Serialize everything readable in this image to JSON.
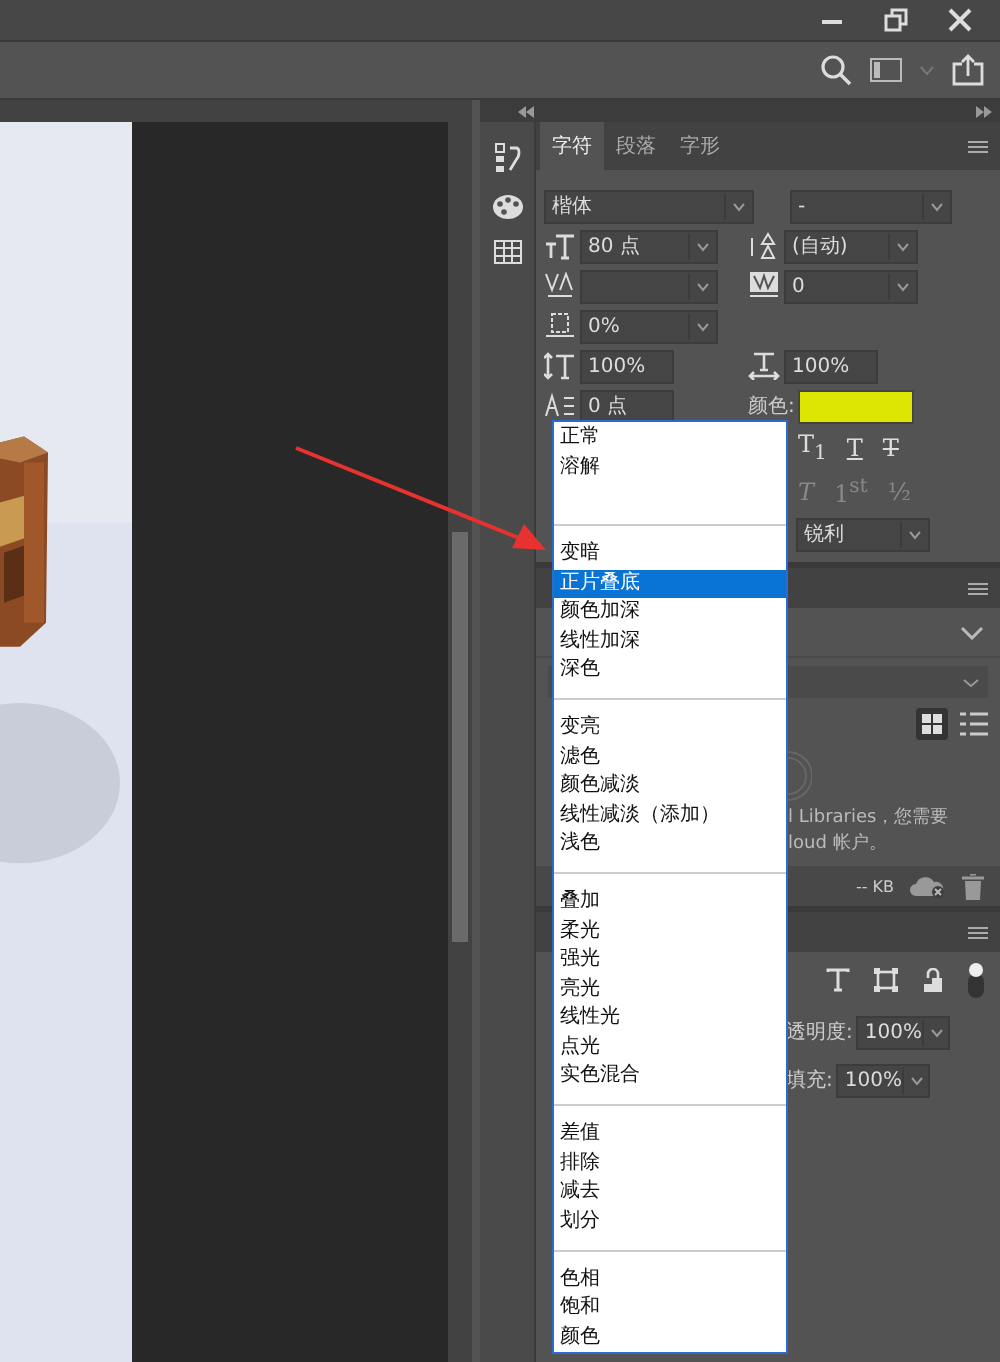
{
  "character_panel": {
    "tabs": [
      {
        "label": "字符",
        "selected": true
      },
      {
        "label": "段落",
        "selected": false
      },
      {
        "label": "字形",
        "selected": false
      }
    ],
    "font_family": "楷体",
    "font_style": "-",
    "font_size": "80 点",
    "leading": "(自动)",
    "tracking": "0",
    "tsume": "0%",
    "vertical_scale": "100%",
    "horizontal_scale": "100%",
    "baseline_shift": "0 点",
    "color_label": "颜色:",
    "style_buttons": [
      {
        "kind": "subscript",
        "label": "T$_{1}$",
        "disabled": false
      },
      {
        "kind": "underline",
        "label": "T",
        "disabled": false
      },
      {
        "kind": "strikethrough",
        "label": "T",
        "disabled": false
      }
    ],
    "opentype_buttons": [
      {
        "kind": "italic",
        "label": "T",
        "disabled": true
      },
      {
        "kind": "plain",
        "label": "1$^{st}$",
        "disabled": true
      },
      {
        "kind": "plain",
        "label": "½",
        "disabled": true
      }
    ],
    "antialias": "锐利"
  },
  "blend_menu": {
    "groups": [
      [
        {
          "label": "正常",
          "selected": false
        },
        {
          "label": "溶解",
          "selected": false
        }
      ],
      [
        {
          "label": "变暗",
          "selected": false
        },
        {
          "label": "正片叠底",
          "selected": true
        },
        {
          "label": "颜色加深",
          "selected": false
        },
        {
          "label": "线性加深",
          "selected": false
        },
        {
          "label": "深色",
          "selected": false
        }
      ],
      [
        {
          "label": "变亮",
          "selected": false
        },
        {
          "label": "滤色",
          "selected": false
        },
        {
          "label": "颜色减淡",
          "selected": false
        },
        {
          "label": "线性减淡（添加）",
          "selected": false
        },
        {
          "label": "浅色",
          "selected": false
        }
      ],
      [
        {
          "label": "叠加",
          "selected": false
        },
        {
          "label": "柔光",
          "selected": false
        },
        {
          "label": "强光",
          "selected": false
        },
        {
          "label": "亮光",
          "selected": false
        },
        {
          "label": "线性光",
          "selected": false
        },
        {
          "label": "点光",
          "selected": false
        },
        {
          "label": "实色混合",
          "selected": false
        }
      ],
      [
        {
          "label": "差值",
          "selected": false
        },
        {
          "label": "排除",
          "selected": false
        },
        {
          "label": "减去",
          "selected": false
        },
        {
          "label": "划分",
          "selected": false
        }
      ],
      [
        {
          "label": "色相",
          "selected": false
        },
        {
          "label": "饱和",
          "selected": false
        },
        {
          "label": "颜色",
          "selected": false
        }
      ]
    ]
  },
  "libraries_panel": {
    "message_lines": [
      "l Libraries，您需要",
      "loud 帐户。"
    ],
    "storage": "-- KB"
  },
  "layers_panel": {
    "opacity_label": "透明度:",
    "opacity": "100%",
    "fill_label": "填充:",
    "fill": "100%"
  }
}
